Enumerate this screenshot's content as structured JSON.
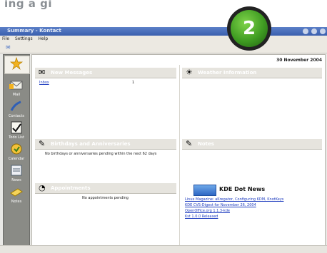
{
  "header": {
    "top_text": "ing a gi",
    "badge_number": "2"
  },
  "window": {
    "title": "Summary - Kontact",
    "menu": [
      "File",
      "Settings",
      "Help"
    ]
  },
  "sidebar": {
    "items": [
      {
        "label": "",
        "icon": "star-icon"
      },
      {
        "label": "Mail",
        "icon": "mail-icon"
      },
      {
        "label": "Contacts",
        "icon": "contacts-icon"
      },
      {
        "label": "Todo List",
        "icon": "todo-icon"
      },
      {
        "label": "Calendar",
        "icon": "calendar-icon"
      },
      {
        "label": "News",
        "icon": "news-icon"
      },
      {
        "label": "Notes",
        "icon": "notes-icon"
      }
    ]
  },
  "summary": {
    "date": "30 November 2004",
    "new_messages": {
      "title": "New Messages",
      "inbox_label": "Inbox",
      "inbox_count": "1"
    },
    "weather": {
      "title": "Weather Information"
    },
    "birthdays": {
      "title": "Birthdays and Anniversaries",
      "text": "No birthdays or anniversaries pending within the next 62 days"
    },
    "notes": {
      "title": "Notes"
    },
    "appointments": {
      "title": "Appointments",
      "text": "No appointments pending"
    },
    "kde_news": {
      "title": "KDE Dot News",
      "links": [
        "Linux Magazine: aKregator, Configuring KDM, KnotKeys",
        "KDE CVS-Digest for November 26, 2004",
        "OpenOffice.org 1.1.3-kde",
        "Kst 1.0.0 Released"
      ]
    }
  }
}
